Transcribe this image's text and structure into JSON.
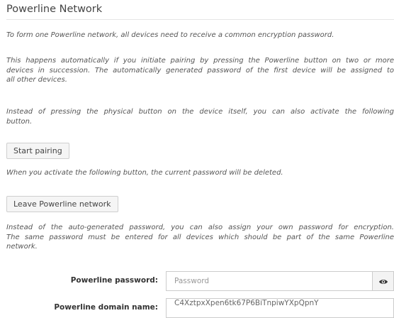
{
  "section": {
    "title": "Powerline Network"
  },
  "paragraphs": {
    "p1": [
      "To form one Powerline network, all devices need to receive a common encryption password."
    ],
    "p2": [
      "This happens automatically if you initiate pairing by pressing the Powerline button on two or more",
      "devices in succession. The automatically generated password of the first device will be assigned to",
      "all other devices."
    ],
    "p3": [
      "Instead of pressing the physical button on the device itself, you can also activate the following",
      "button."
    ],
    "p4": [
      "When you activate the following button, the current password will be deleted."
    ],
    "p5": [
      "Instead of the auto-generated password, you can also assign your own password for encryption.",
      "The same password must be entered for all devices which should be part of the same Powerline",
      "network."
    ]
  },
  "buttons": {
    "start_pairing": "Start pairing",
    "leave_network": "Leave Powerline network"
  },
  "form": {
    "password_label": "Powerline password:",
    "password_placeholder": "Password",
    "password_value": "",
    "domain_label": "Powerline domain name:",
    "domain_value": "C4XztpxXpen6tk67P6BiTnpiwYXpQpnY"
  },
  "icons": {
    "visibility": "eye-icon"
  }
}
